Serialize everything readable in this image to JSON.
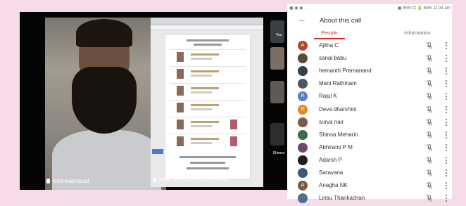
{
  "call": {
    "speaker_name": "Krishnaprasad",
    "shared_screen_caption": "Vimal Jyothi School Coimbatore",
    "side_tiles": [
      "You",
      "",
      "",
      "Shimes"
    ]
  },
  "status_bar": {
    "left": "▣ ◉ ◉ ···",
    "right": "▣ 85% ⊡ 🔋 63% 11:34 am"
  },
  "header": {
    "back_icon": "arrow-left-icon",
    "title": "About this call"
  },
  "tabs": [
    {
      "label": "People"
    },
    {
      "label": "Information"
    }
  ],
  "participants": [
    {
      "name": "Ajitha C",
      "initial": "A",
      "color": "#b5462e"
    },
    {
      "name": "sanal babu",
      "initial": "",
      "color": "#5a4a3f"
    },
    {
      "name": "hemanth Premanand",
      "initial": "",
      "color": "#33404d"
    },
    {
      "name": "Mani Rathinam",
      "initial": "",
      "color": "#4b5563"
    },
    {
      "name": "Rajul K",
      "initial": "R",
      "color": "#5b7fb8"
    },
    {
      "name": "Deva dharshini",
      "initial": "D",
      "color": "#e08a1e"
    },
    {
      "name": "surya nair",
      "initial": "",
      "color": "#7a5d4a"
    },
    {
      "name": "Shinsa Meharin",
      "initial": "",
      "color": "#3e6b4c"
    },
    {
      "name": "Abhirami P M",
      "initial": "",
      "color": "#6c4a6e"
    },
    {
      "name": "Adarsh P",
      "initial": "",
      "color": "#1e1e1e"
    },
    {
      "name": "Saravana",
      "initial": "",
      "color": "#3b5b7a"
    },
    {
      "name": "Anagha NK",
      "initial": "A",
      "color": "#7d5a46"
    },
    {
      "name": "Linsu Thankachan",
      "initial": "",
      "color": "#4d6f8a"
    }
  ]
}
